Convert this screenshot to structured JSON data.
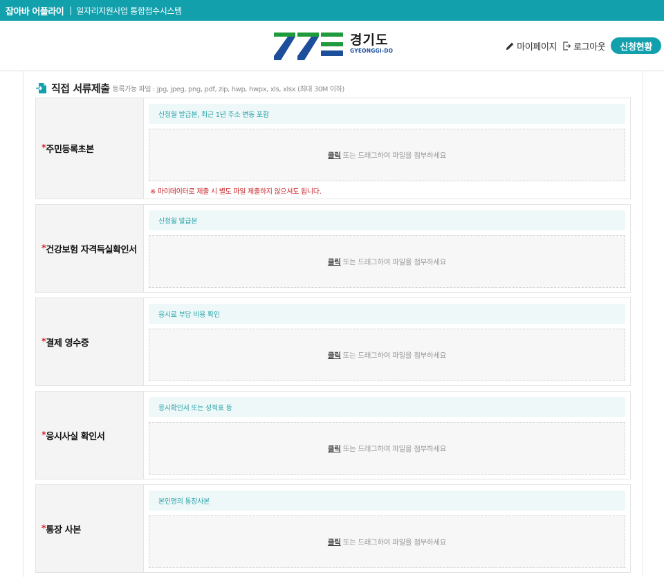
{
  "topbar": {
    "brand": "잡아바 어플라이",
    "separator": "|",
    "system": "일자리지원사업 통합접수시스템"
  },
  "header": {
    "logo": {
      "title": "경기도",
      "subtitle": "GYEONGGI-DO"
    },
    "menu": {
      "mypage_label": "마이페이지",
      "logout_label": "로그아웃",
      "status_label": "신청현황"
    }
  },
  "section": {
    "title": "직접 서류제출",
    "hint": "등록가능 파일 : jpg, jpeg, png, pdf, zip, hwp, hwpx, xls, xlsx (최대 30M 이하)"
  },
  "dropzone": {
    "click_label": "클릭",
    "rest_label": "또는 드래그하여 파일을 첨부하세요"
  },
  "documents": [
    {
      "required_mark": "*",
      "label": "주민등록초본",
      "note": "신청월 발급본, 최근 1년 주소 변동 포함",
      "warning": "※ 마이데이터로 제출 시 별도 파일 제출하지 않으셔도 됩니다."
    },
    {
      "required_mark": "*",
      "label": "건강보험 자격득실확인서",
      "note": "신청월 발급본"
    },
    {
      "required_mark": "*",
      "label": "결제 영수증",
      "note": "응시료 부담 비용 확인"
    },
    {
      "required_mark": "*",
      "label": "응시사실 확인서",
      "note": "응시확인서 또는 성적표 등"
    },
    {
      "required_mark": "*",
      "label": "통장 사본",
      "note": "본인명의 통장사본"
    }
  ],
  "colors": {
    "accent": "#12a0ad",
    "required": "#d8262b",
    "note_text": "#2aa3a9",
    "logo_green": "#1f9a3c",
    "logo_blue": "#1c4e9c"
  }
}
